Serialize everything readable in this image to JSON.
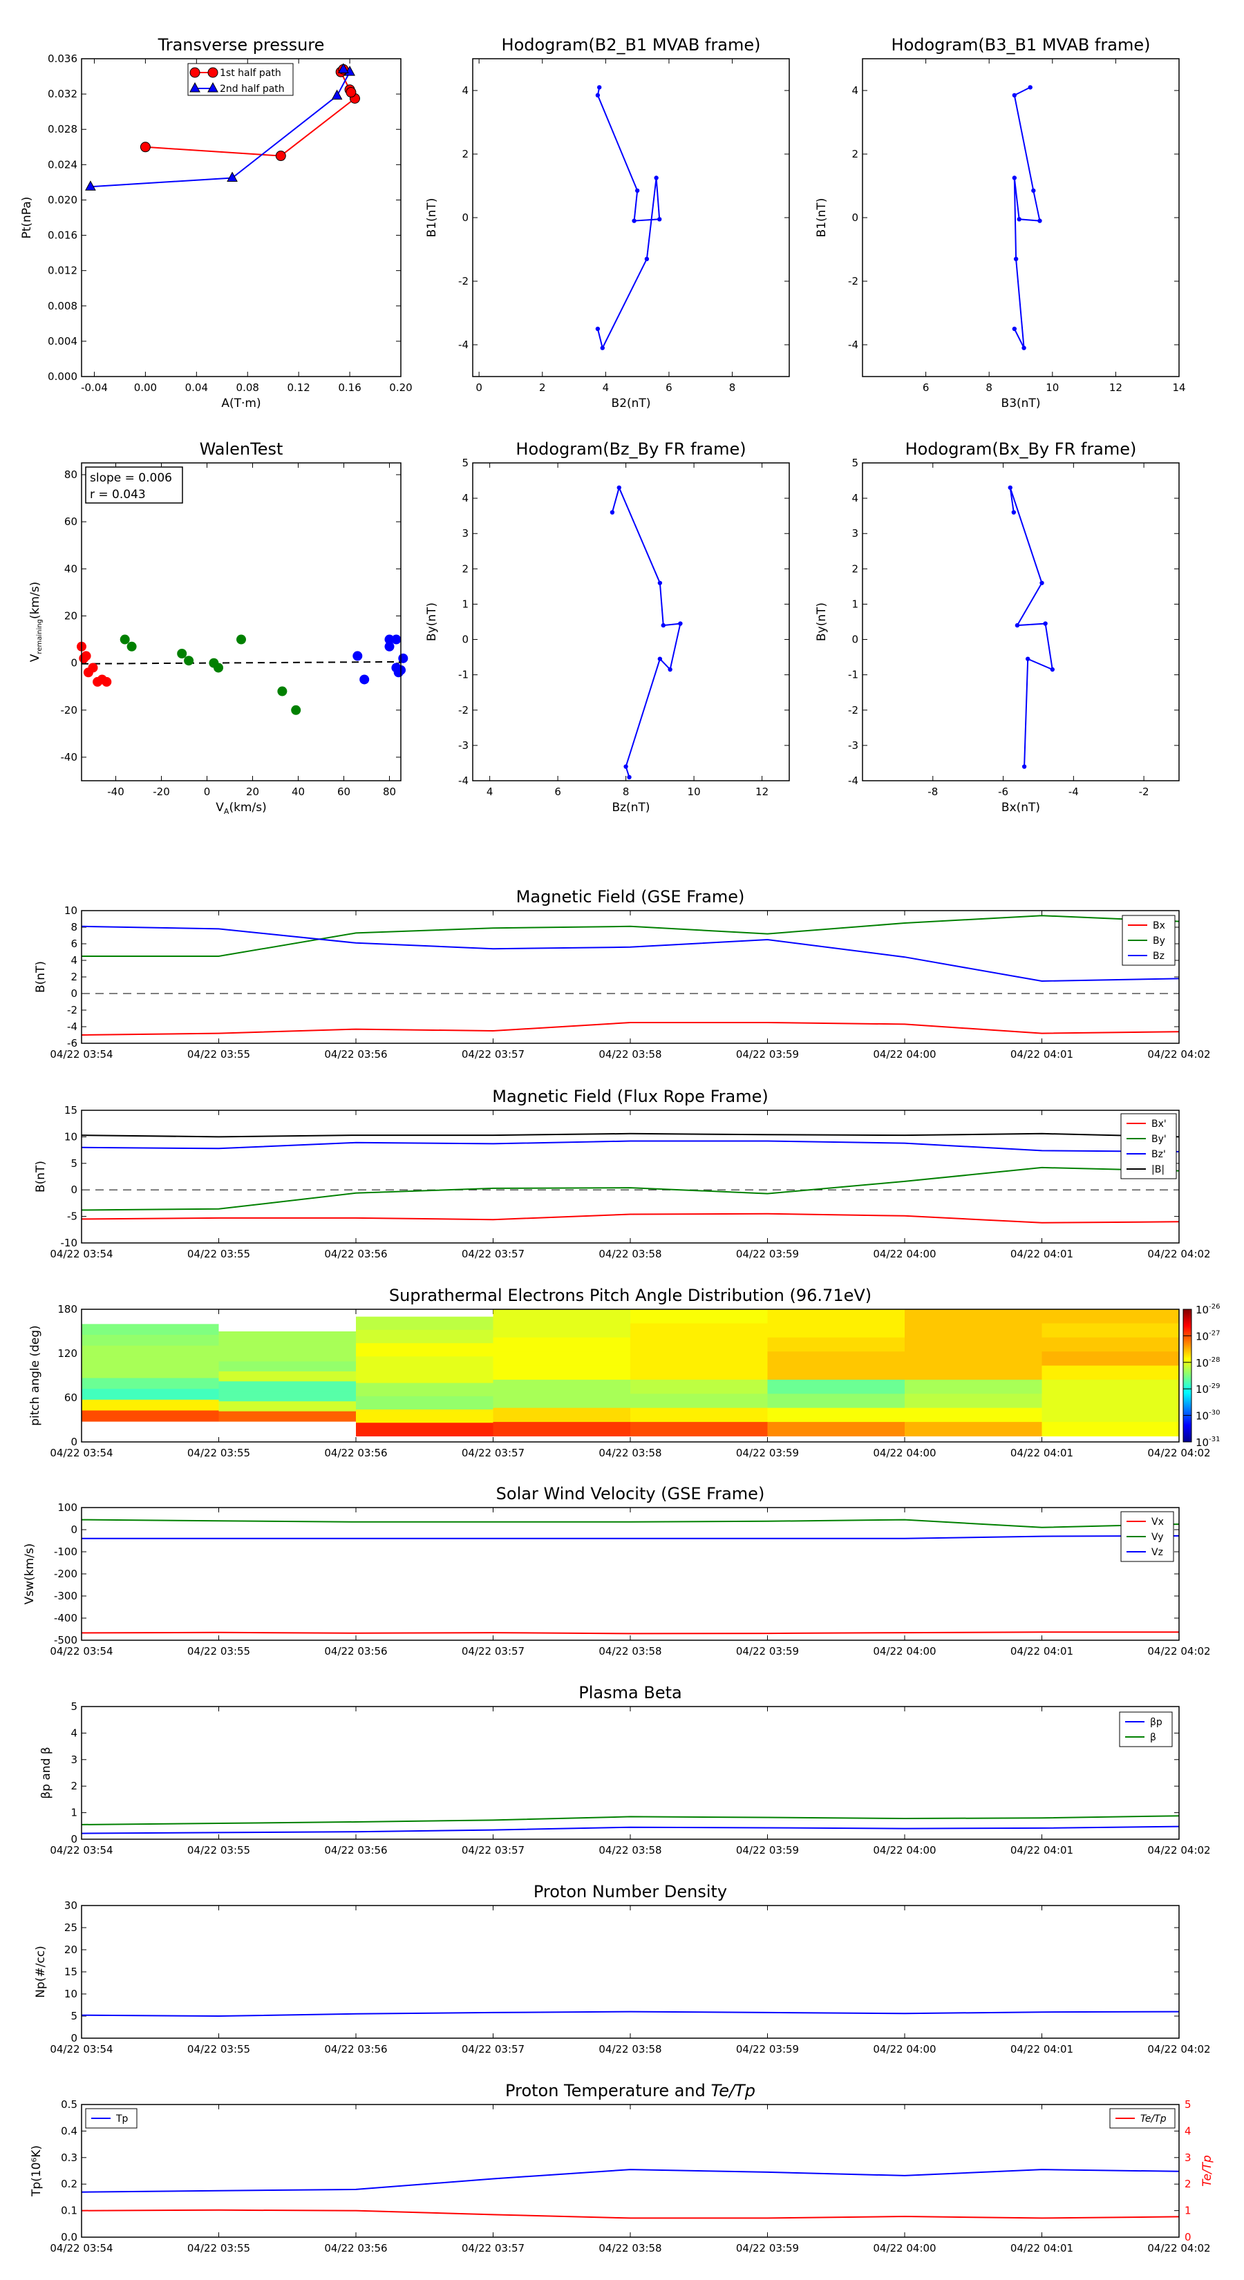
{
  "time_ticks": [
    "04/22 03:54",
    "04/22 03:55",
    "04/22 03:56",
    "04/22 03:57",
    "04/22 03:58",
    "04/22 03:59",
    "04/22 04:00",
    "04/22 04:01",
    "04/22 04:02"
  ],
  "colors": {
    "red": "#ff0000",
    "green": "#008000",
    "blue": "#0000ff",
    "black": "#000000",
    "darkred": "#cc0000"
  },
  "chart_data": [
    {
      "id": "transverse",
      "type": "scatter",
      "title": "Transverse pressure",
      "xlabel": "A(T·m)",
      "ylabel": "Pt(nPa)",
      "xlim": [
        -0.05,
        0.2
      ],
      "ylim": [
        0,
        0.036
      ],
      "xticks": [
        "-0.04",
        "0.00",
        "0.04",
        "0.08",
        "0.12",
        "0.16",
        "0.20"
      ],
      "yticks": [
        "0.000",
        "0.004",
        "0.008",
        "0.012",
        "0.016",
        "0.020",
        "0.024",
        "0.028",
        "0.032",
        "0.036"
      ],
      "legend": "top-center",
      "series": [
        {
          "name": "1st half path",
          "color": "red",
          "marker": "circle",
          "x": [
            0.0,
            0.106,
            0.164,
            0.16,
            0.161,
            0.153,
            0.155
          ],
          "y": [
            0.026,
            0.025,
            0.0315,
            0.0325,
            0.0322,
            0.0345,
            0.0348
          ]
        },
        {
          "name": "2nd half path",
          "color": "blue",
          "marker": "triangle",
          "x": [
            -0.043,
            0.068,
            0.15,
            0.16,
            0.155
          ],
          "y": [
            0.0215,
            0.0225,
            0.0318,
            0.0345,
            0.0348
          ]
        }
      ]
    },
    {
      "id": "hodo1",
      "type": "line",
      "title": "Hodogram(B2_B1 MVAB frame)",
      "xlabel": "B2(nT)",
      "ylabel": "B1(nT)",
      "xlim": [
        -0.2,
        9.8
      ],
      "ylim": [
        -5,
        5
      ],
      "xticks": [
        "0",
        "2",
        "4",
        "6",
        "8"
      ],
      "yticks": [
        "-4",
        "-2",
        "0",
        "2",
        "4"
      ],
      "series": [
        {
          "color": "blue",
          "x": [
            3.8,
            3.75,
            5.0,
            4.9,
            5.7,
            5.6,
            5.3,
            3.9,
            3.75
          ],
          "y": [
            4.1,
            3.85,
            0.85,
            -0.1,
            -0.05,
            1.25,
            -1.3,
            -4.1,
            -3.5
          ]
        }
      ]
    },
    {
      "id": "hodo2",
      "type": "line",
      "title": "Hodogram(B3_B1 MVAB frame)",
      "xlabel": "B3(nT)",
      "ylabel": "B1(nT)",
      "xlim": [
        4,
        14
      ],
      "ylim": [
        -5,
        5
      ],
      "xticks": [
        "6",
        "8",
        "10",
        "12",
        "14"
      ],
      "yticks": [
        "-4",
        "-2",
        "0",
        "2",
        "4"
      ],
      "series": [
        {
          "color": "blue",
          "x": [
            9.3,
            8.8,
            9.4,
            9.6,
            8.95,
            8.8,
            8.85,
            9.1,
            8.8
          ],
          "y": [
            4.1,
            3.85,
            0.85,
            -0.1,
            -0.05,
            1.25,
            -1.3,
            -4.1,
            -3.5
          ]
        }
      ]
    },
    {
      "id": "walen",
      "type": "scatter",
      "title": "WalenTest",
      "xlabel": "V",
      "xlabel_sub": "A",
      "xlabel_unit": "(km/s)",
      "ylabel": "V",
      "ylabel_sub": "remaining",
      "ylabel_unit": "(km/s)",
      "xlim": [
        -55,
        85
      ],
      "ylim": [
        -50,
        85
      ],
      "xticks": [
        "-40",
        "-20",
        "0",
        "20",
        "40",
        "60",
        "80"
      ],
      "yticks": [
        "-40",
        "-20",
        "0",
        "20",
        "40",
        "60",
        "80"
      ],
      "annotation": [
        "slope = 0.006",
        "r = 0.043"
      ],
      "fit_slope": 0.006,
      "series": [
        {
          "color": "red",
          "x": [
            -55,
            -54,
            -53,
            -52,
            -50,
            -48,
            -46,
            -44
          ],
          "y": [
            7,
            2,
            3,
            -4,
            -2,
            -8,
            -7,
            -8
          ]
        },
        {
          "color": "green",
          "x": [
            -36,
            -33,
            -11,
            -8,
            3,
            5,
            15,
            33,
            39
          ],
          "y": [
            10,
            7,
            4,
            1,
            0,
            -2,
            10,
            -12,
            -20
          ]
        },
        {
          "color": "blue",
          "x": [
            66,
            69,
            80,
            80,
            83,
            83,
            84,
            85,
            86
          ],
          "y": [
            3,
            -7,
            10,
            7,
            10,
            -2,
            -4,
            -3,
            2
          ]
        }
      ]
    },
    {
      "id": "hodo3",
      "type": "line",
      "title": "Hodogram(Bz_By FR frame)",
      "xlabel": "Bz(nT)",
      "ylabel": "By(nT)",
      "xlim": [
        3.5,
        12.8
      ],
      "ylim": [
        -4,
        5
      ],
      "xticks": [
        "4",
        "6",
        "8",
        "10",
        "12"
      ],
      "yticks": [
        "-4",
        "-3",
        "-2",
        "-1",
        "0",
        "1",
        "2",
        "3",
        "4",
        "5"
      ],
      "series": [
        {
          "color": "blue",
          "x": [
            7.6,
            7.8,
            9.0,
            9.1,
            9.6,
            9.3,
            9.0,
            8.0,
            8.1
          ],
          "y": [
            3.6,
            4.3,
            1.6,
            0.4,
            0.45,
            -0.85,
            -0.55,
            -3.6,
            -3.9
          ]
        }
      ]
    },
    {
      "id": "hodo4",
      "type": "line",
      "title": "Hodogram(Bx_By FR frame)",
      "xlabel": "Bx(nT)",
      "ylabel": "By(nT)",
      "xlim": [
        -10,
        -1
      ],
      "ylim": [
        -4,
        5
      ],
      "xticks": [
        "-8",
        "-6",
        "-4",
        "-2"
      ],
      "yticks": [
        "-4",
        "-3",
        "-2",
        "-1",
        "0",
        "1",
        "2",
        "3",
        "4",
        "5"
      ],
      "series": [
        {
          "color": "blue",
          "x": [
            -5.7,
            -5.8,
            -4.9,
            -5.6,
            -4.8,
            -4.6,
            -5.3,
            -5.4
          ],
          "y": [
            3.6,
            4.3,
            1.6,
            0.4,
            0.45,
            -0.85,
            -0.55,
            -3.6
          ]
        }
      ]
    },
    {
      "id": "bgse",
      "type": "line",
      "title": "Magnetic Field (GSE Frame)",
      "ylabel": "B(nT)",
      "ylim": [
        -6,
        10
      ],
      "yticks": [
        "-6",
        "-4",
        "-2",
        "0",
        "2",
        "4",
        "6",
        "8",
        "10"
      ],
      "x": [
        0,
        1,
        2,
        3,
        4,
        5,
        6,
        7,
        8
      ],
      "zero_line": true,
      "legend": "top-right",
      "series": [
        {
          "name": "Bx",
          "color": "red",
          "values": [
            -5.0,
            -4.8,
            -4.3,
            -4.5,
            -3.5,
            -3.5,
            -3.7,
            -4.8,
            -4.6
          ]
        },
        {
          "name": "By",
          "color": "green",
          "values": [
            4.5,
            4.5,
            7.3,
            7.9,
            8.1,
            7.2,
            8.5,
            9.4,
            8.7
          ]
        },
        {
          "name": "Bz",
          "color": "blue",
          "values": [
            8.1,
            7.8,
            6.1,
            5.4,
            5.6,
            6.5,
            4.4,
            1.5,
            1.8
          ]
        }
      ]
    },
    {
      "id": "bfr",
      "type": "line",
      "title": "Magnetic Field (Flux Rope Frame)",
      "ylabel": "B(nT)",
      "ylim": [
        -10,
        15
      ],
      "yticks": [
        "-10",
        "-5",
        "0",
        "5",
        "10",
        "15"
      ],
      "x": [
        0,
        1,
        2,
        3,
        4,
        5,
        6,
        7,
        8
      ],
      "zero_line": true,
      "legend": "top-right",
      "series": [
        {
          "name": "Bx'",
          "color": "red",
          "values": [
            -5.5,
            -5.3,
            -5.3,
            -5.6,
            -4.6,
            -4.5,
            -4.9,
            -6.2,
            -6.0
          ]
        },
        {
          "name": "By'",
          "color": "green",
          "values": [
            -3.8,
            -3.6,
            -0.6,
            0.3,
            0.4,
            -0.7,
            1.6,
            4.2,
            3.6
          ]
        },
        {
          "name": "Bz'",
          "color": "blue",
          "values": [
            8.0,
            7.8,
            8.9,
            8.7,
            9.2,
            9.2,
            8.8,
            7.4,
            7.2
          ]
        },
        {
          "name": "|B|",
          "color": "black",
          "values": [
            10.3,
            10.0,
            10.3,
            10.3,
            10.6,
            10.4,
            10.3,
            10.6,
            10.0
          ]
        }
      ]
    },
    {
      "id": "pad",
      "type": "heatmap",
      "title": "Suprathermal Electrons Pitch Angle Distribution (96.71eV)",
      "ylabel": "pitch angle (deg)",
      "ylim": [
        0,
        180
      ],
      "yticks": [
        "0",
        "60",
        "120",
        "180"
      ],
      "colorbar_ticks": [
        "-26",
        "-27",
        "-28",
        "-29",
        "-30",
        "-31"
      ],
      "colorbar_base": "10",
      "column_tops": [
        160,
        150,
        170,
        180,
        180,
        180,
        180,
        180
      ],
      "column_bottoms": [
        28,
        28,
        8,
        8,
        8,
        8,
        8,
        8
      ],
      "values": [
        [
          -28.5,
          -28.4,
          -28.3,
          -28.3,
          -28.3,
          -28.6,
          -28.8,
          -27.8,
          -27.0
        ],
        [
          -28.3,
          -28.3,
          -28.3,
          -28.4,
          -28.1,
          -28.7,
          -28.7,
          -28.1,
          -27.1
        ],
        [
          -28.2,
          -28.1,
          -27.9,
          -28.0,
          -28.0,
          -28.3,
          -28.4,
          -27.8,
          -26.8
        ],
        [
          -28.0,
          -28.0,
          -27.9,
          -27.9,
          -27.9,
          -28.3,
          -28.3,
          -27.7,
          -26.9
        ],
        [
          -27.9,
          -27.8,
          -27.8,
          -27.8,
          -27.8,
          -28.2,
          -28.3,
          -27.8,
          -27.0
        ],
        [
          -27.8,
          -27.8,
          -27.7,
          -27.6,
          -27.6,
          -28.6,
          -28.4,
          -27.9,
          -27.3
        ],
        [
          -27.6,
          -27.6,
          -27.6,
          -27.6,
          -27.6,
          -28.3,
          -28.2,
          -27.9,
          -27.5
        ],
        [
          -27.6,
          -27.7,
          -27.6,
          -27.5,
          -27.8,
          -28.0,
          -28.0,
          -28.0,
          -27.9
        ]
      ]
    },
    {
      "id": "vsw",
      "type": "line",
      "title": "Solar Wind Velocity (GSE Frame)",
      "ylabel": "Vsw(km/s)",
      "ylim": [
        -500,
        100
      ],
      "yticks": [
        "-500",
        "-400",
        "-300",
        "-200",
        "-100",
        "0",
        "100"
      ],
      "x": [
        0,
        1,
        2,
        3,
        4,
        5,
        6,
        7,
        8
      ],
      "legend": "top-right",
      "series": [
        {
          "name": "Vx",
          "color": "red",
          "values": [
            -467,
            -465,
            -468,
            -466,
            -470,
            -469,
            -466,
            -463,
            -463
          ]
        },
        {
          "name": "Vy",
          "color": "green",
          "values": [
            45,
            40,
            35,
            35,
            35,
            38,
            45,
            10,
            25
          ]
        },
        {
          "name": "Vz",
          "color": "blue",
          "values": [
            -40,
            -40,
            -40,
            -40,
            -40,
            -40,
            -40,
            -30,
            -28
          ]
        }
      ]
    },
    {
      "id": "beta",
      "type": "line",
      "title": "Plasma Beta",
      "ylabel": "βp and β",
      "ylim": [
        0,
        5
      ],
      "yticks": [
        "0",
        "1",
        "2",
        "3",
        "4",
        "5"
      ],
      "x": [
        0,
        1,
        2,
        3,
        4,
        5,
        6,
        7,
        8
      ],
      "legend": "top-right",
      "series": [
        {
          "name": "βp",
          "color": "blue",
          "values": [
            0.22,
            0.25,
            0.28,
            0.35,
            0.45,
            0.43,
            0.4,
            0.42,
            0.48
          ]
        },
        {
          "name": "β",
          "color": "green",
          "values": [
            0.55,
            0.6,
            0.65,
            0.72,
            0.85,
            0.82,
            0.78,
            0.8,
            0.88
          ]
        }
      ]
    },
    {
      "id": "np",
      "type": "line",
      "title": "Proton Number Density",
      "ylabel": "Np(#/cc)",
      "ylim": [
        0,
        30
      ],
      "yticks": [
        "0",
        "5",
        "10",
        "15",
        "20",
        "25",
        "30"
      ],
      "x": [
        0,
        1,
        2,
        3,
        4,
        5,
        6,
        7,
        8
      ],
      "series": [
        {
          "color": "blue",
          "values": [
            5.2,
            5.0,
            5.5,
            5.8,
            6.0,
            5.8,
            5.6,
            5.9,
            6.0
          ]
        }
      ]
    },
    {
      "id": "tp",
      "type": "line",
      "title": "Proton Temperature and Te/Tp",
      "title_main": "Proton Temperature and ",
      "title_math": "Te/Tp",
      "ylabel": "Tp(10⁶K)",
      "ylabel_right": "Te/Tp",
      "ylim": [
        0,
        0.5
      ],
      "yticks": [
        "0.0",
        "0.1",
        "0.2",
        "0.3",
        "0.4",
        "0.5"
      ],
      "ylim_right": [
        0,
        5
      ],
      "yticks_right": [
        "0",
        "1",
        "2",
        "3",
        "4",
        "5"
      ],
      "x": [
        0,
        1,
        2,
        3,
        4,
        5,
        6,
        7,
        8
      ],
      "series": [
        {
          "name": "Tp",
          "color": "blue",
          "axis": "left",
          "values": [
            0.17,
            0.175,
            0.18,
            0.22,
            0.255,
            0.245,
            0.232,
            0.255,
            0.248
          ]
        },
        {
          "name": "Te/Tp",
          "color": "red",
          "axis": "right",
          "values": [
            1.0,
            1.02,
            1.0,
            0.85,
            0.72,
            0.72,
            0.78,
            0.72,
            0.77
          ]
        }
      ]
    }
  ]
}
